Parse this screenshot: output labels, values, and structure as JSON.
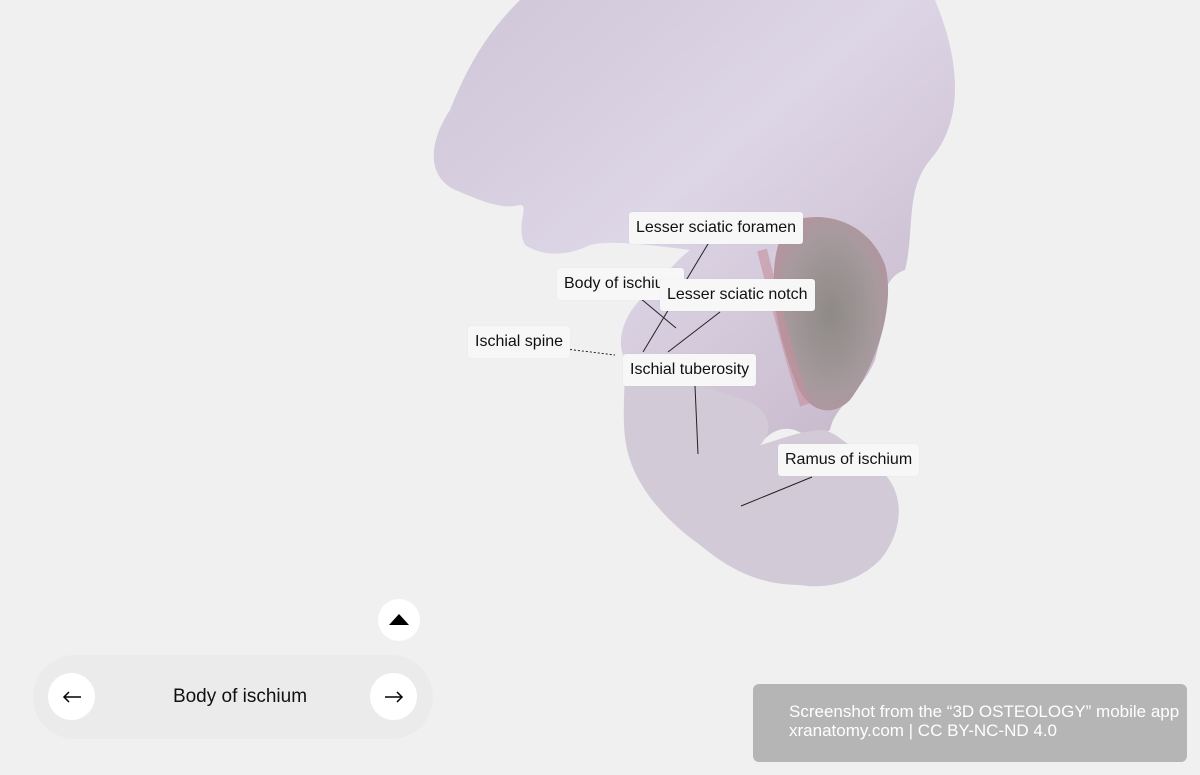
{
  "labels": {
    "lesser_sciatic_foramen": "Lesser sciatic foramen",
    "body_of_ischium": "Body of ischium",
    "lesser_sciatic_notch": "Lesser sciatic notch",
    "ischial_spine": "Ischial spine",
    "ischial_tuberosity": "Ischial tuberosity",
    "ramus_of_ischium": "Ramus of ischium"
  },
  "nav": {
    "title": "Body of ischium",
    "prev_icon": "arrow-left-icon",
    "next_icon": "arrow-right-icon",
    "expand_icon": "caret-up-icon"
  },
  "credit": {
    "line1": "Screenshot from the “3D OSTEOLOGY” mobile app",
    "line2": "xranatomy.com | CC BY-NC-ND 4.0"
  },
  "colors": {
    "background": "#f0f0f0",
    "bone_light": "#d9d4e3",
    "bone_dark": "#b79aab",
    "credit_bg": "#b5b5b5"
  }
}
